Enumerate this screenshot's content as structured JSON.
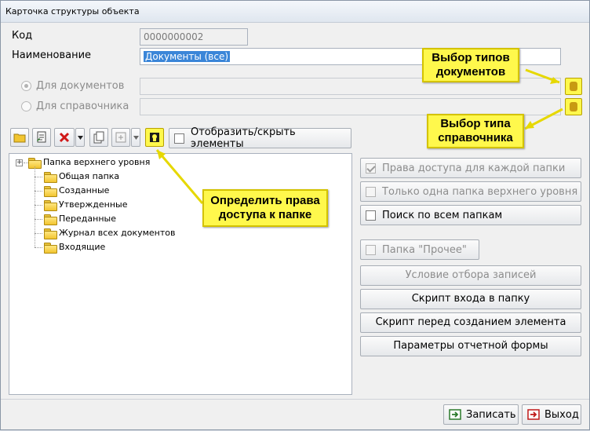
{
  "window": {
    "title": "Карточка структуры объекта"
  },
  "form": {
    "code_label": "Код",
    "code_value": "0000000002",
    "name_label": "Наименование",
    "name_value": "Документы (все)",
    "radio_documents": "Для документов",
    "radio_reference": "Для справочника"
  },
  "toolbar": {
    "show_hide_label": "Отобразить/скрыть элементы"
  },
  "tree": {
    "root": "Папка верхнего уровня",
    "children": [
      "Общая папка",
      "Созданные",
      "Утвержденные",
      "Переданные",
      "Журнал всех документов",
      "Входящие"
    ]
  },
  "options": {
    "access_each_folder": "Права доступа для каждой папки",
    "only_one_top_folder": "Только одна папка верхнего уровня",
    "search_all_folders": "Поиск по всем папкам",
    "other_folder": "Папка \"Прочее\""
  },
  "actions": {
    "record_filter": "Условие отбора записей",
    "enter_folder_script": "Скрипт входа в папку",
    "before_create_script": "Скрипт перед созданием элемента",
    "report_params": "Параметры отчетной формы"
  },
  "footer": {
    "save_label": "Записать",
    "exit_label": "Выход"
  },
  "callouts": {
    "doc_types": "Выбор типов документов",
    "ref_type": "Выбор типа справочника",
    "folder_access": "Определить права доступа к папке"
  },
  "colors": {
    "callout_fill": "#fff84c",
    "selection": "#3b86d8"
  }
}
